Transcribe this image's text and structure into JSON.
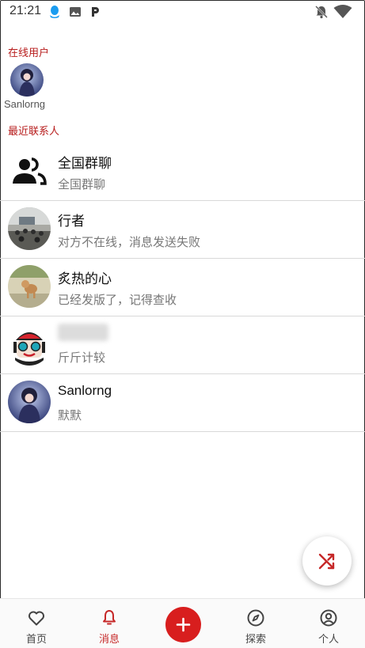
{
  "status_bar": {
    "time": "21:21",
    "left_icons": [
      "qq-icon",
      "image-icon",
      "p-icon"
    ],
    "right_icons": [
      "bell-off-icon",
      "wifi-icon"
    ]
  },
  "online_section": {
    "label": "在线用户",
    "users": [
      {
        "name": "Sanlorng"
      }
    ]
  },
  "recent_section": {
    "label": "最近联系人"
  },
  "contacts": [
    {
      "name": "全国群聊",
      "message": "全国群聊",
      "avatar": "group-icon"
    },
    {
      "name": "行者",
      "message": "对方不在线，消息发送失败"
    },
    {
      "name": "炙热的心",
      "message": "已经发版了，记得查收"
    },
    {
      "name": "",
      "message": "斤斤计较",
      "name_blurred": true
    },
    {
      "name": "Sanlorng",
      "message": "默默"
    }
  ],
  "fab": {
    "icon": "shuffle-icon"
  },
  "bottom_nav": {
    "items": [
      {
        "label": "首页",
        "icon": "heart-icon"
      },
      {
        "label": "消息",
        "icon": "bell-icon",
        "active": true
      },
      {
        "label": "",
        "icon": "plus-icon"
      },
      {
        "label": "探索",
        "icon": "compass-icon"
      },
      {
        "label": "个人",
        "icon": "user-circle-icon"
      }
    ]
  },
  "colors": {
    "accent": "#c62828",
    "plus_button": "#d81e1e",
    "secondary_text": "#777777",
    "divider": "#d9d9d9"
  }
}
